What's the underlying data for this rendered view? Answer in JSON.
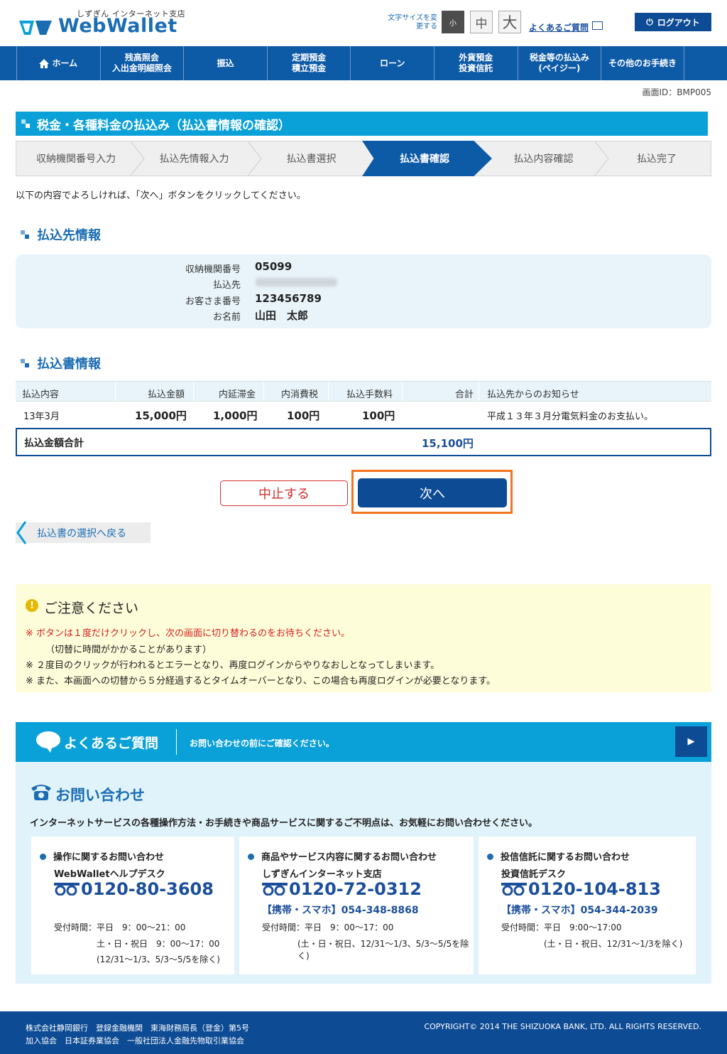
{
  "header": {
    "logo_sub": "しずぎん インターネット支店",
    "logo_text": "WebWallet",
    "font_size_label": "文字サイズを変更する",
    "font_small": "小",
    "font_mid": "中",
    "font_large": "大",
    "faq_link": "よくあるご質問",
    "logout": "ログアウト"
  },
  "nav": {
    "home": "ホーム",
    "balance_1": "残高照会",
    "balance_2": "入出金明細照会",
    "transfer": "振込",
    "time_deposit_1": "定期預金",
    "time_deposit_2": "積立預金",
    "loan": "ローン",
    "foreign_1": "外貨預金",
    "foreign_2": "投資信託",
    "payeasy_1": "税金等の払込み",
    "payeasy_2": "(ペイジー)",
    "other": "その他のお手続き"
  },
  "screen_id": "画面ID：BMP005",
  "page_title": "税金・各種料金の払込み（払込書情報の確認）",
  "steps": [
    "収納機関番号入力",
    "払込先情報入力",
    "払込書選択",
    "払込書確認",
    "払込内容確認",
    "払込完了"
  ],
  "instruction": "以下の内容でよろしければ、「次へ」ボタンをクリックしてください。",
  "payee": {
    "section_title": "払込先情報",
    "institution_label": "収納機関番号",
    "institution_value": "05099",
    "payee_label": "払込先",
    "customer_label": "お客さま番号",
    "customer_value": "123456789",
    "name_label": "お名前",
    "name_value": "山田　太郎"
  },
  "bill": {
    "section_title": "払込書情報",
    "headers": {
      "content": "払込内容",
      "amount": "払込金額",
      "late_fee": "内延滞金",
      "tax": "内消費税",
      "fee": "払込手数料",
      "total": "合計",
      "notice": "払込先からのお知らせ"
    },
    "row": {
      "content": "13年3月",
      "amount": "15,000円",
      "late_fee": "1,000円",
      "tax": "100円",
      "fee": "100円",
      "notice": "平成１３年３月分電気料金のお支払い。"
    },
    "total_label": "払込金額合計",
    "total_value": "15,100円"
  },
  "buttons": {
    "cancel": "中止する",
    "next": "次へ",
    "back": "払込書の選択へ戻る"
  },
  "notice": {
    "title": "ご注意ください",
    "line1": "※ ボタンは１度だけクリックし、次の画面に切り替わるのをお待ちください。",
    "line2": "（切替に時間がかかることがあります）",
    "line3": "※ ２度目のクリックが行われるとエラーとなり、再度ログインからやりなおしとなってしまいます。",
    "line4": "※ また、本画面への切替から５分経過するとタイムオーバーとなり、この場合も再度ログインが必要となります。"
  },
  "faq": {
    "title": "よくあるご質問",
    "desc": "お問い合わせの前にご確認ください。"
  },
  "contact": {
    "title": "お問い合わせ",
    "desc": "インターネットサービスの各種操作方法・お手続きや商品サービスに関するご不明点は、お気軽にお問い合わせください。",
    "card1": {
      "heading": "操作に関するお問い合わせ",
      "name": "WebWalletヘルプデスク",
      "tel": "0120-80-3608",
      "hours1": "受付時間：平日　9：00～21：00",
      "hours2": "土・日・祝日　9：00～17：00",
      "hours3": "(12/31～1/3、5/3～5/5を除く)"
    },
    "card2": {
      "heading": "商品やサービス内容に関するお問い合わせ",
      "name": "しずぎんインターネット支店",
      "tel": "0120-72-0312",
      "mobile": "【携帯・スマホ】054-348-8868",
      "hours1": "受付時間：平日　9：00～17：00",
      "hours2": "(土・日・祝日、12/31～1/3、5/3～5/5を除く)"
    },
    "card3": {
      "heading": "投信信託に関するお問い合わせ",
      "name": "投資信託デスク",
      "tel": "0120-104-813",
      "mobile": "【携帯・スマホ】054-344-2039",
      "hours1": "受付時間：平日　9:00～17:00",
      "hours2": "(土・日・祝日、12/31～1/3を除く)"
    }
  },
  "footer": {
    "line1": "株式会社静岡銀行　登録金融機関　東海財務局長（登金）第5号",
    "line2": "加入協会　日本証券業協会　一般社団法人金融先物取引業協会",
    "copyright": "COPYRIGHT© 2014 THE SHIZUOKA BANK, LTD. ALL RIGHTS RESERVED."
  },
  "colors": {
    "primary": "#0d4b94",
    "nav": "#0d5aa7",
    "accent_cyan": "#0aa0d8",
    "cancel_red": "#d03030",
    "highlight_orange": "#f47420"
  }
}
